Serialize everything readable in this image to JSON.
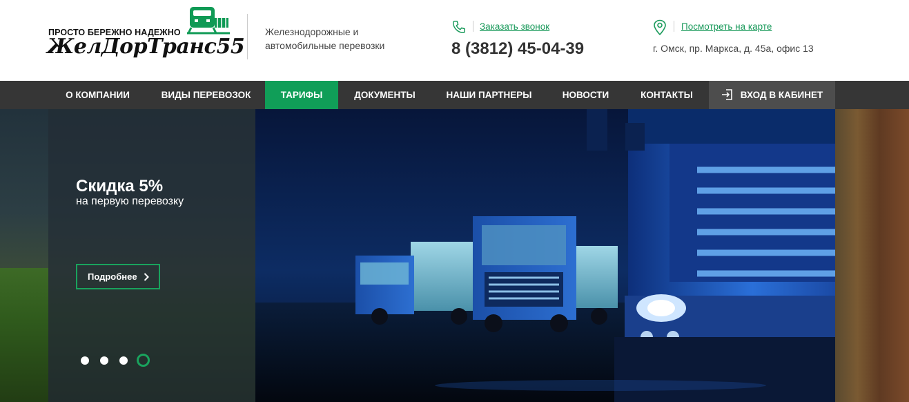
{
  "header": {
    "slogan": "ПРОСТО БЕРЕЖНО НАДЕЖНО",
    "brand": "ЖелДорТранс55",
    "tagline": "Железнодорожные и автомобильные перевозки",
    "callback_label": "Заказать звонок",
    "phone": "8 (3812) 45-04-39",
    "map_label": "Посмотреть на карте",
    "address": "г. Омск, пр. Маркса, д. 45а, офис 13"
  },
  "nav": {
    "items": [
      {
        "label": "О КОМПАНИИ"
      },
      {
        "label": "ВИДЫ ПЕРЕВОЗОК"
      },
      {
        "label": "ТАРИФЫ"
      },
      {
        "label": "ДОКУМЕНТЫ"
      },
      {
        "label": "НАШИ ПАРТНЕРЫ"
      },
      {
        "label": "НОВОСТИ"
      },
      {
        "label": "КОНТАКТЫ"
      }
    ],
    "active_index": 2,
    "login_label": "ВХОД В КАБИНЕТ"
  },
  "hero": {
    "title": "Скидка 5%",
    "subtitle": "на первую перевозку",
    "button_label": "Подробнее",
    "slides_count": 4,
    "active_slide": 4
  },
  "colors": {
    "accent": "#109e58",
    "nav_bg": "#363636",
    "login_bg": "#4d4d4d"
  },
  "icons": {
    "phone": "phone-icon",
    "location": "location-pin-icon",
    "login": "login-icon",
    "chevron": "chevron-right-icon",
    "logo": "train-icon"
  }
}
